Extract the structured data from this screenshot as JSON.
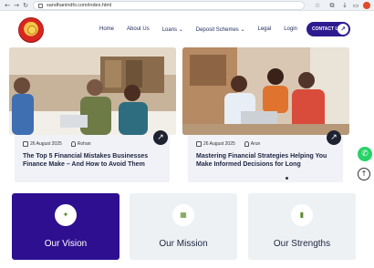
{
  "browser": {
    "url": "sandhanindhi.com/index.html",
    "back_icon": "back-arrow-icon",
    "forward_icon": "forward-arrow-icon",
    "reload_icon": "reload-icon"
  },
  "header": {
    "nav": [
      "Home",
      "About Us",
      "Loans",
      "Deposit Schemes",
      "Legal",
      "Login"
    ],
    "contact_label": "CONTACT US",
    "accent": "#2e1b8f"
  },
  "posts": [
    {
      "date": "26 August 2025",
      "author": "Rohan",
      "title": "The Top 5 Financial Mistakes Businesses Finance Make – And How to Avoid Them"
    },
    {
      "date": "26 August 2025",
      "author": "Arun",
      "title": "Mastering Financial Strategies Helping You Make Informed Decisions for Long"
    }
  ],
  "features": [
    {
      "title": "Our Vision",
      "icon": "vision-icon",
      "bg": "#2e0f8f",
      "fg": "#ffffff"
    },
    {
      "title": "Our Mission",
      "icon": "mission-icon",
      "bg": "#eef1f4",
      "fg": "#1d2440"
    },
    {
      "title": "Our Strengths",
      "icon": "strengths-icon",
      "bg": "#eef1f4",
      "fg": "#1d2440"
    }
  ]
}
